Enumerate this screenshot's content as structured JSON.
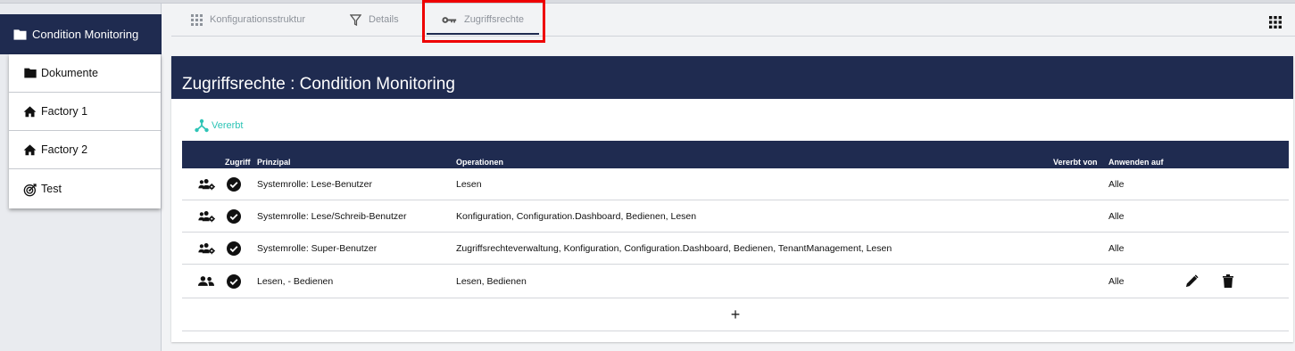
{
  "nav": {
    "root": {
      "label": "Condition Monitoring",
      "icon": "folder-icon"
    },
    "items": [
      {
        "label": "Dokumente",
        "icon": "folder-icon"
      },
      {
        "label": "Factory 1",
        "icon": "home-icon"
      },
      {
        "label": "Factory 2",
        "icon": "home-icon"
      },
      {
        "label": "Test",
        "icon": "target-icon"
      }
    ]
  },
  "tabs": [
    {
      "label": "Konfigurationsstruktur",
      "icon": "grid-icon"
    },
    {
      "label": "Details",
      "icon": "filter-icon"
    },
    {
      "label": "Zugriffsrechte",
      "icon": "key-icon",
      "active": true
    }
  ],
  "card": {
    "title": "Zugriffsrechte : Condition Monitoring",
    "inherit_label": "Vererbt"
  },
  "table": {
    "headers": {
      "access": "Zugriff",
      "principal": "Prinzipal",
      "operations": "Operationen",
      "inherited_from": "Vererbt von",
      "apply_to": "Anwenden auf"
    },
    "rows": [
      {
        "principal": "Systemrolle: Lese-Benutzer",
        "operations": "Lesen",
        "apply_to": "Alle",
        "icon": "group-gear-icon"
      },
      {
        "principal": "Systemrolle: Lese/Schreib-Benutzer",
        "operations": "Konfiguration,  Configuration.Dashboard,  Bedienen,  Lesen",
        "apply_to": "Alle",
        "icon": "group-gear-icon"
      },
      {
        "principal": "Systemrolle: Super-Benutzer",
        "operations": "Zugriffsrechteverwaltung,  Konfiguration,  Configuration.Dashboard,  Bedienen,  TenantManagement,  Lesen",
        "apply_to": "Alle",
        "icon": "group-gear-icon"
      },
      {
        "principal": "Lesen, - Bedienen",
        "operations": "Lesen,  Bedienen",
        "apply_to": "Alle",
        "icon": "group-icon",
        "editable": true
      }
    ],
    "add_label": "+"
  },
  "colors": {
    "navy": "#1f2b50",
    "teal": "#2ec4b6",
    "highlight": "#ee0000"
  }
}
